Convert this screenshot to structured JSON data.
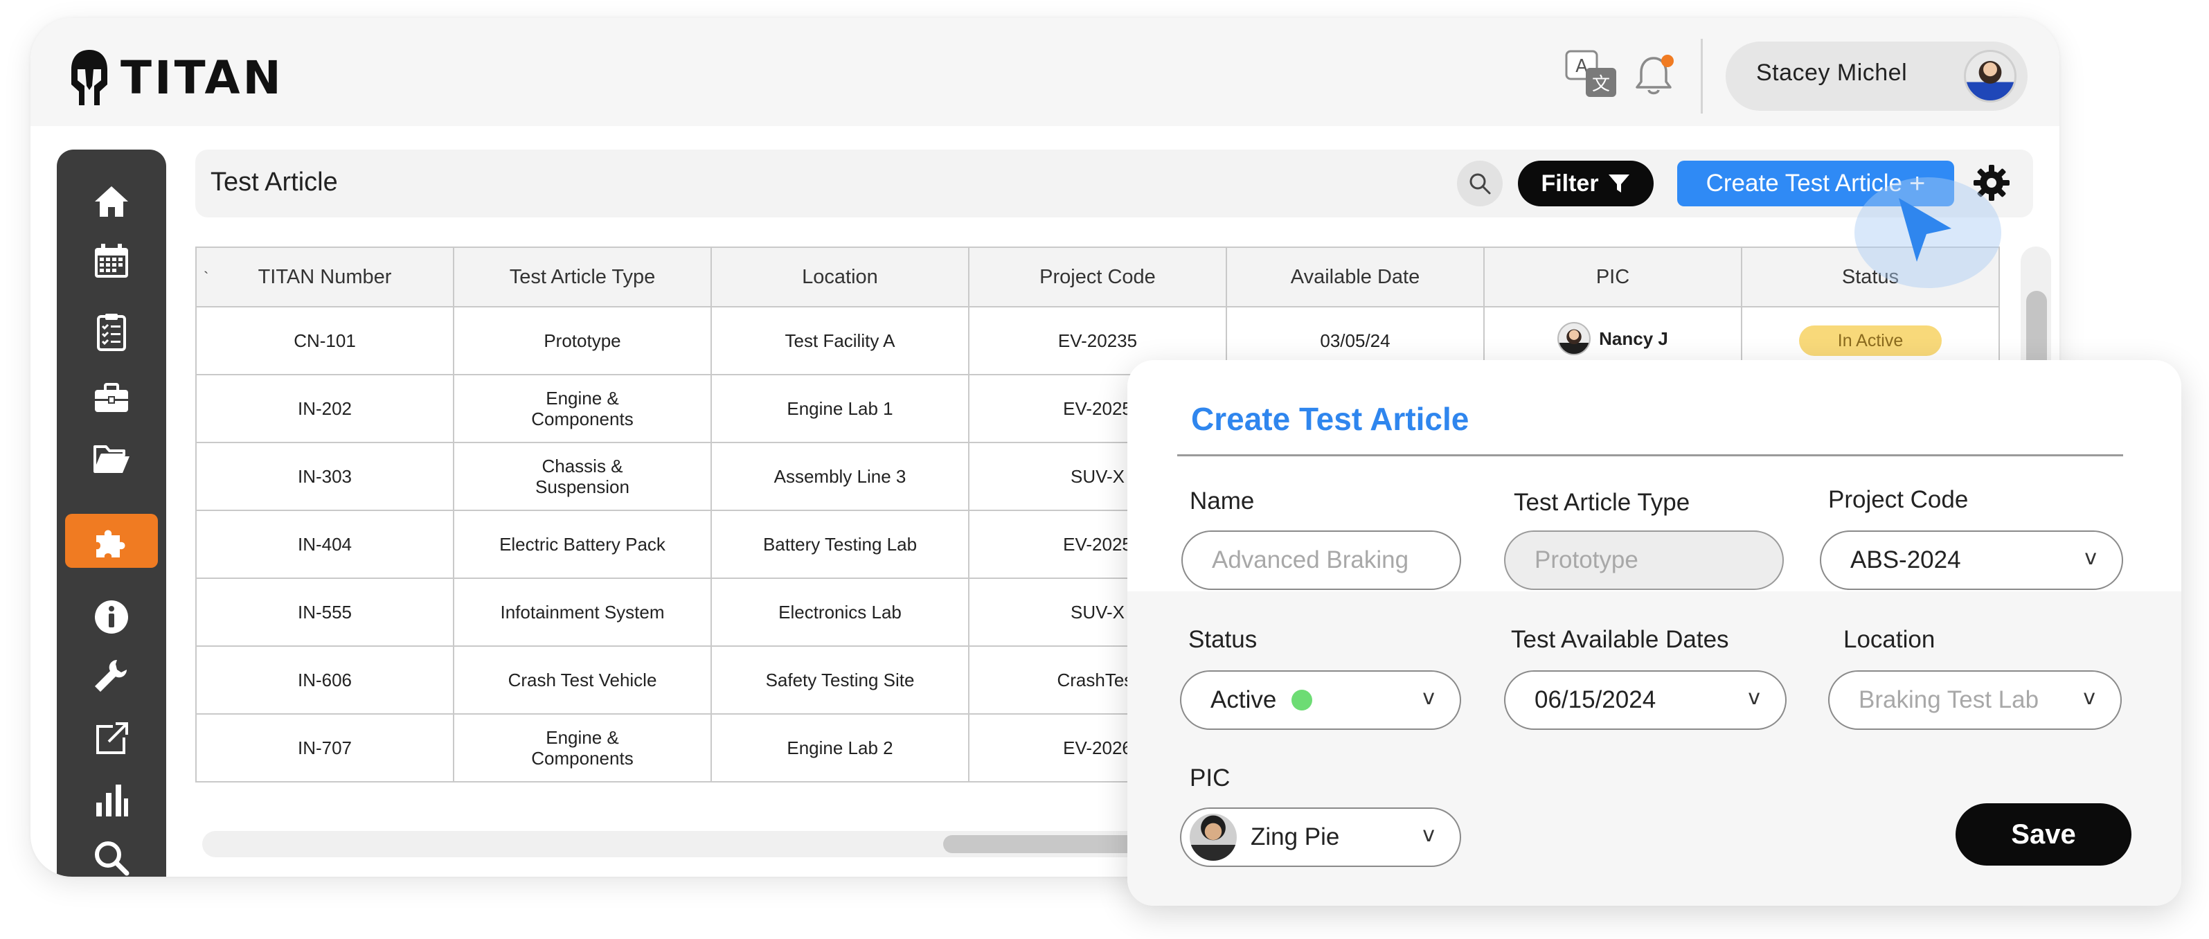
{
  "app": {
    "name": "TITAN",
    "user_name": "Stacey Michel"
  },
  "icons": {
    "logo": "spartan-helmet-icon",
    "translate": "translate-icon",
    "notifications": "bell-icon",
    "notification_dot_color": "#f07b22"
  },
  "colors": {
    "accent_blue": "#2f8af5",
    "sidebar_active": "#f07b22",
    "sidebar_bg": "#3c3c3c",
    "status_badge": "#f8d97a",
    "active_dot": "#6ddc74"
  },
  "sidebar": {
    "items": [
      {
        "icon": "home-icon",
        "active": false
      },
      {
        "icon": "calendar-icon",
        "active": false
      },
      {
        "icon": "clipboard-checklist-icon",
        "active": false
      },
      {
        "icon": "briefcase-icon",
        "active": false
      },
      {
        "icon": "folder-open-icon",
        "active": false
      },
      {
        "icon": "puzzle-icon",
        "active": true
      },
      {
        "icon": "info-icon",
        "active": false
      },
      {
        "icon": "wrench-icon",
        "active": false
      },
      {
        "icon": "external-link-icon",
        "active": false
      },
      {
        "icon": "bar-chart-icon",
        "active": false
      },
      {
        "icon": "search-icon",
        "active": false
      }
    ]
  },
  "toolbar": {
    "title": "Test Article",
    "filter_label": "Filter",
    "create_label": "Create Test Article",
    "create_plus": "+"
  },
  "table": {
    "columns": [
      "TITAN Number",
      "Test Article Type",
      "Location",
      "Project Code",
      "Available Date",
      "PIC",
      "Status"
    ],
    "sort_indicator": "`",
    "rows": [
      {
        "titan": "CN-101",
        "type": "Prototype",
        "location": "Test Facility A",
        "project": "EV-20235",
        "date": "03/05/24",
        "pic": "Nancy J",
        "status": "In Active"
      },
      {
        "titan": "IN-202",
        "type": "Engine &\nComponents",
        "location": "Engine Lab 1",
        "project": "EV-2025",
        "date": "",
        "pic": "",
        "status": ""
      },
      {
        "titan": "IN-303",
        "type": "Chassis &\nSuspension",
        "location": "Assembly Line 3",
        "project": "SUV-X",
        "date": "",
        "pic": "",
        "status": ""
      },
      {
        "titan": "IN-404",
        "type": "Electric Battery Pack",
        "location": "Battery Testing Lab",
        "project": "EV-2025",
        "date": "",
        "pic": "",
        "status": ""
      },
      {
        "titan": "IN-555",
        "type": "Infotainment System",
        "location": "Electronics Lab",
        "project": "SUV-X",
        "date": "",
        "pic": "",
        "status": ""
      },
      {
        "titan": "IN-606",
        "type": "Crash Test Vehicle",
        "location": "Safety Testing Site",
        "project": "CrashTest",
        "date": "",
        "pic": "",
        "status": ""
      },
      {
        "titan": "IN-707",
        "type": "Engine &\nComponents",
        "location": "Engine Lab 2",
        "project": "EV-2026",
        "date": "",
        "pic": "",
        "status": ""
      }
    ]
  },
  "modal": {
    "title": "Create Test Article",
    "name_label": "Name",
    "name_placeholder": "Advanced Braking",
    "type_label": "Test Article Type",
    "type_placeholder": "Prototype",
    "project_label": "Project Code",
    "project_value": "ABS-2024",
    "status_label": "Status",
    "status_value": "Active",
    "dates_label": "Test Available Dates",
    "dates_value": "06/15/2024",
    "location_label": "Location",
    "location_placeholder": "Braking Test Lab",
    "pic_label": "PIC",
    "pic_value": "Zing Pie",
    "caret": "v",
    "save_label": "Save"
  }
}
